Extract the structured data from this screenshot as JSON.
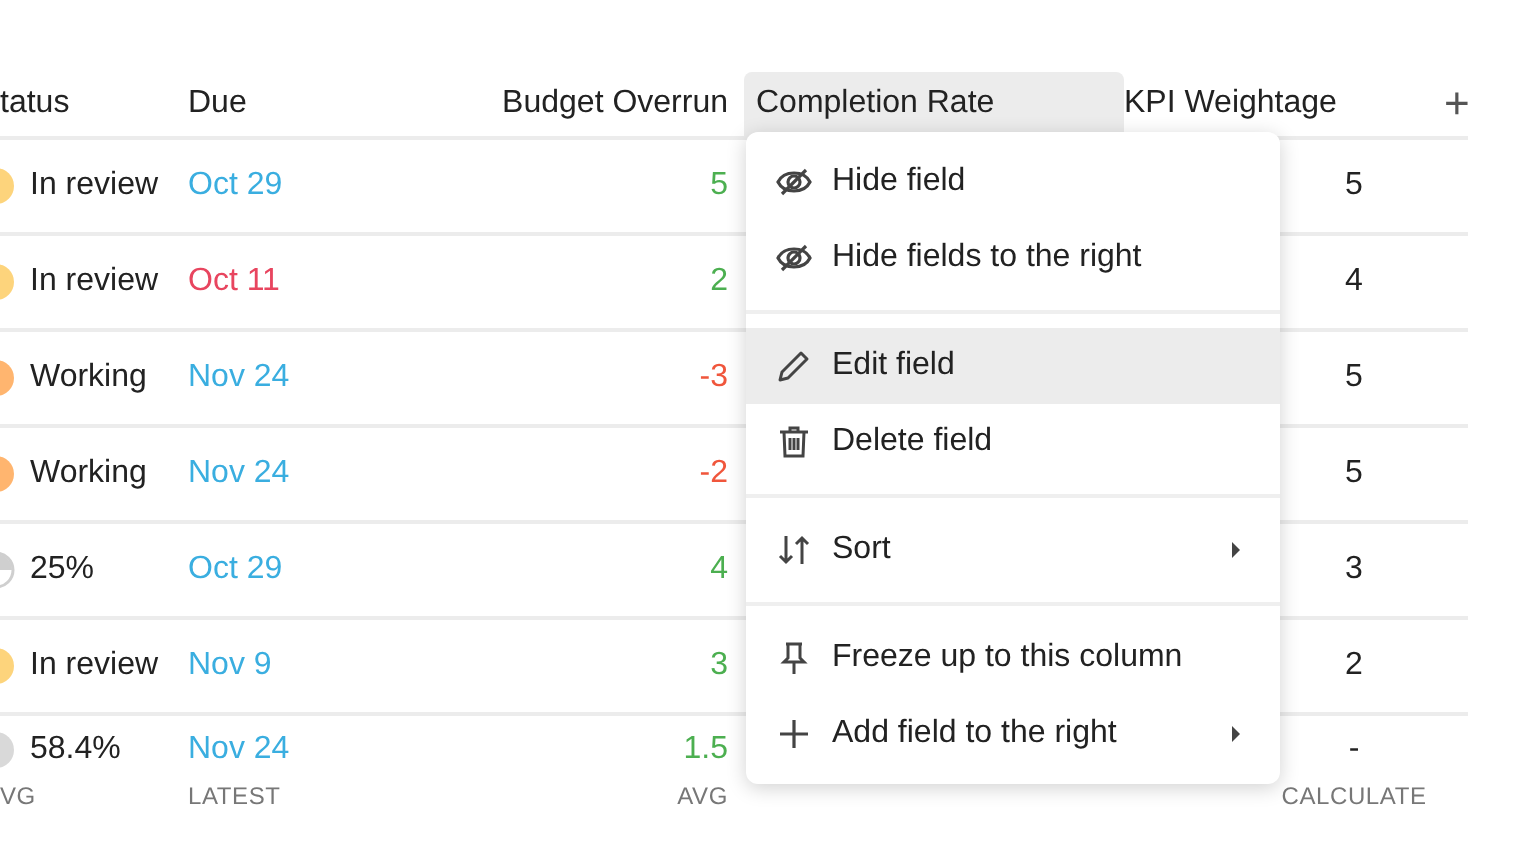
{
  "table": {
    "columns": [
      {
        "label": "tatus",
        "active": false
      },
      {
        "label": "Due",
        "active": false
      },
      {
        "label": "Budget Overrun",
        "active": false
      },
      {
        "label": "Completion Rate",
        "active": true
      },
      {
        "label": "KPI Weightage",
        "active": false
      }
    ],
    "rows": [
      {
        "status": {
          "kind": "dot",
          "color": "#fdd47c",
          "label": "In review"
        },
        "due": {
          "text": "Oct 29",
          "color": "#3aaee0"
        },
        "overrun": {
          "text": "5",
          "color": "#4caf50"
        },
        "kpi": "5"
      },
      {
        "status": {
          "kind": "dot",
          "color": "#fdd47c",
          "label": "In review"
        },
        "due": {
          "text": "Oct 11",
          "color": "#e8455f"
        },
        "overrun": {
          "text": "2",
          "color": "#4caf50"
        },
        "kpi": "4"
      },
      {
        "status": {
          "kind": "dot",
          "color": "#ffb56f",
          "label": "Working"
        },
        "due": {
          "text": "Nov 24",
          "color": "#3aaee0"
        },
        "overrun": {
          "text": "-3",
          "color": "#f0563c"
        },
        "kpi": "5"
      },
      {
        "status": {
          "kind": "dot",
          "color": "#ffb56f",
          "label": "Working"
        },
        "due": {
          "text": "Nov 24",
          "color": "#3aaee0"
        },
        "overrun": {
          "text": "-2",
          "color": "#f0563c"
        },
        "kpi": "5"
      },
      {
        "status": {
          "kind": "pie",
          "label": "25%"
        },
        "due": {
          "text": "Oct 29",
          "color": "#3aaee0"
        },
        "overrun": {
          "text": "4",
          "color": "#4caf50"
        },
        "kpi": "3"
      },
      {
        "status": {
          "kind": "dot",
          "color": "#fdd47c",
          "label": "In review"
        },
        "due": {
          "text": "Nov 9",
          "color": "#3aaee0"
        },
        "overrun": {
          "text": "3",
          "color": "#4caf50"
        },
        "kpi": "2"
      }
    ],
    "summary": {
      "status": {
        "kind": "dot",
        "color": "#d9d9d9",
        "label": "58.4%"
      },
      "due": {
        "text": "Nov 24",
        "color": "#3aaee0"
      },
      "overrun": {
        "text": "1.5",
        "color": "#4caf50"
      },
      "kpi": "-"
    },
    "summary_labels": {
      "status": "VG",
      "due": "LATEST",
      "overrun": "AVG",
      "kpi": "CALCULATE"
    },
    "add_column": "+"
  },
  "menu": {
    "sections": [
      [
        {
          "kind": "hide",
          "label": "Hide field",
          "highlighted": false,
          "submenu": false
        },
        {
          "kind": "hide",
          "label": "Hide fields to the right",
          "highlighted": false,
          "submenu": false
        }
      ],
      [
        {
          "kind": "edit",
          "label": "Edit field",
          "highlighted": true,
          "submenu": false
        },
        {
          "kind": "delete",
          "label": "Delete field",
          "highlighted": false,
          "submenu": false
        }
      ],
      [
        {
          "kind": "sort",
          "label": "Sort",
          "highlighted": false,
          "submenu": true
        }
      ],
      [
        {
          "kind": "freeze",
          "label": "Freeze up to this column",
          "highlighted": false,
          "submenu": false
        },
        {
          "kind": "add",
          "label": "Add field to the right",
          "highlighted": false,
          "submenu": true
        }
      ]
    ]
  }
}
